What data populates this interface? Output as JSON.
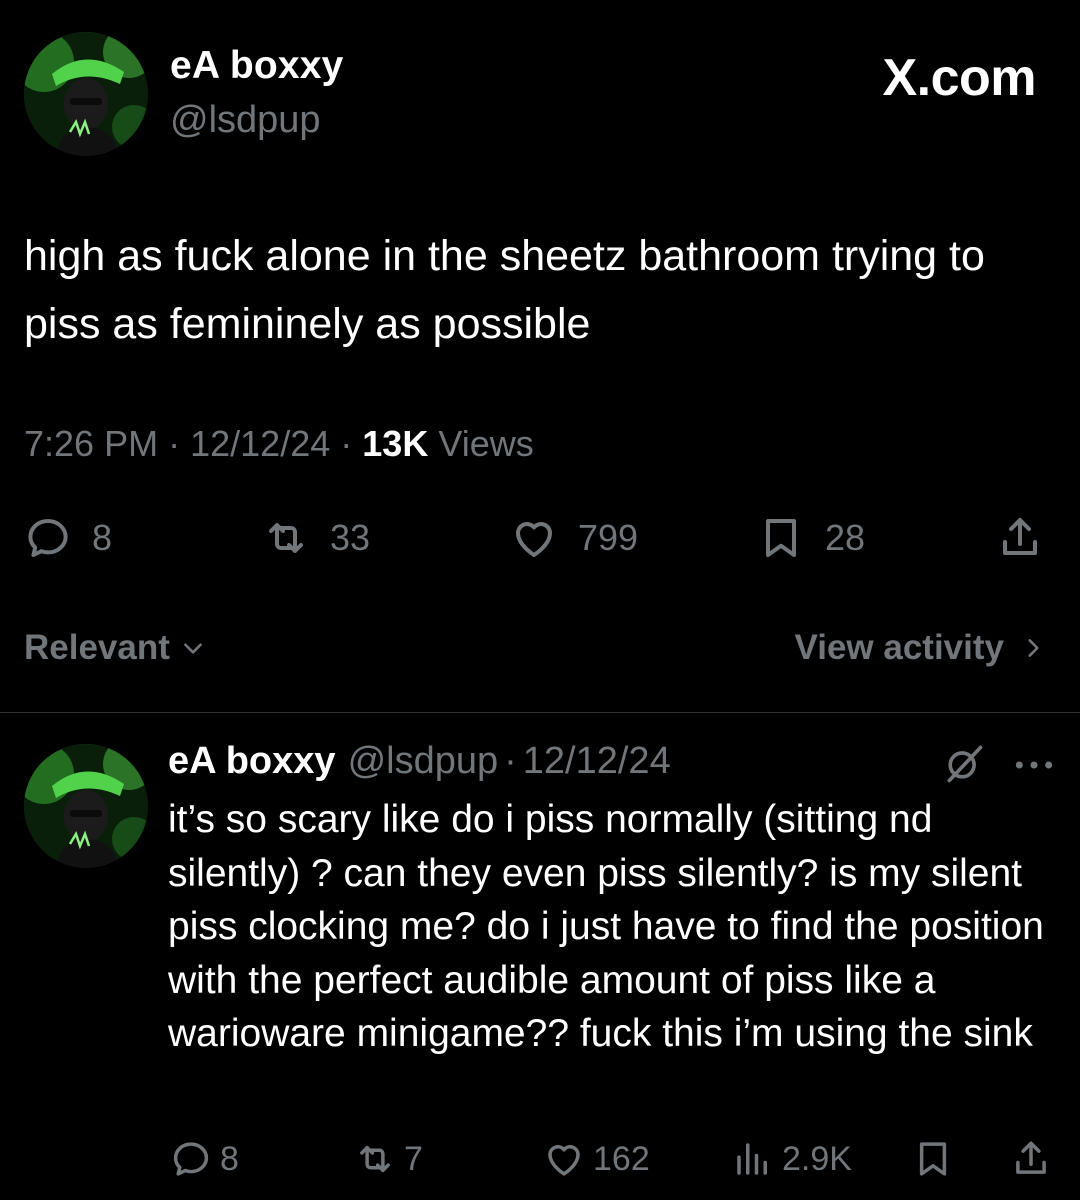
{
  "watermark": "X.com",
  "tweet": {
    "author_name": "eA boxxy",
    "author_handle": "@lsdpup",
    "text": "high as fuck alone in the sheetz bathroom trying to piss as femininely as possible",
    "time": "7:26 PM",
    "date": "12/12/24",
    "views_count": "13K",
    "views_label": "Views",
    "separator": "·",
    "replies": "8",
    "reposts": "33",
    "likes": "799",
    "bookmarks": "28"
  },
  "replies_bar": {
    "sort_label": "Relevant",
    "activity_label": "View activity"
  },
  "reply": {
    "author_name": "eA boxxy",
    "author_handle": "@lsdpup",
    "separator": "·",
    "date": "12/12/24",
    "text": "it’s so scary like do i piss normally (sitting nd silently) ? can they even piss silently? is my silent piss clocking me? do i just have to find the position with the perfect audible amount of piss like a warioware minigame?? fuck this i’m using the sink",
    "replies": "8",
    "reposts": "7",
    "likes": "162",
    "views": "2.9K"
  },
  "colors": {
    "background": "#000000",
    "primary_text": "#ffffff",
    "secondary_text": "#71767b",
    "divider": "#2f3336",
    "avatar_accent": "#3fb83a"
  },
  "icons": [
    "reply-icon",
    "repost-icon",
    "like-icon",
    "bookmark-icon",
    "share-icon",
    "chevron-down-icon",
    "chevron-right-icon",
    "grok-icon",
    "more-icon",
    "views-icon"
  ]
}
